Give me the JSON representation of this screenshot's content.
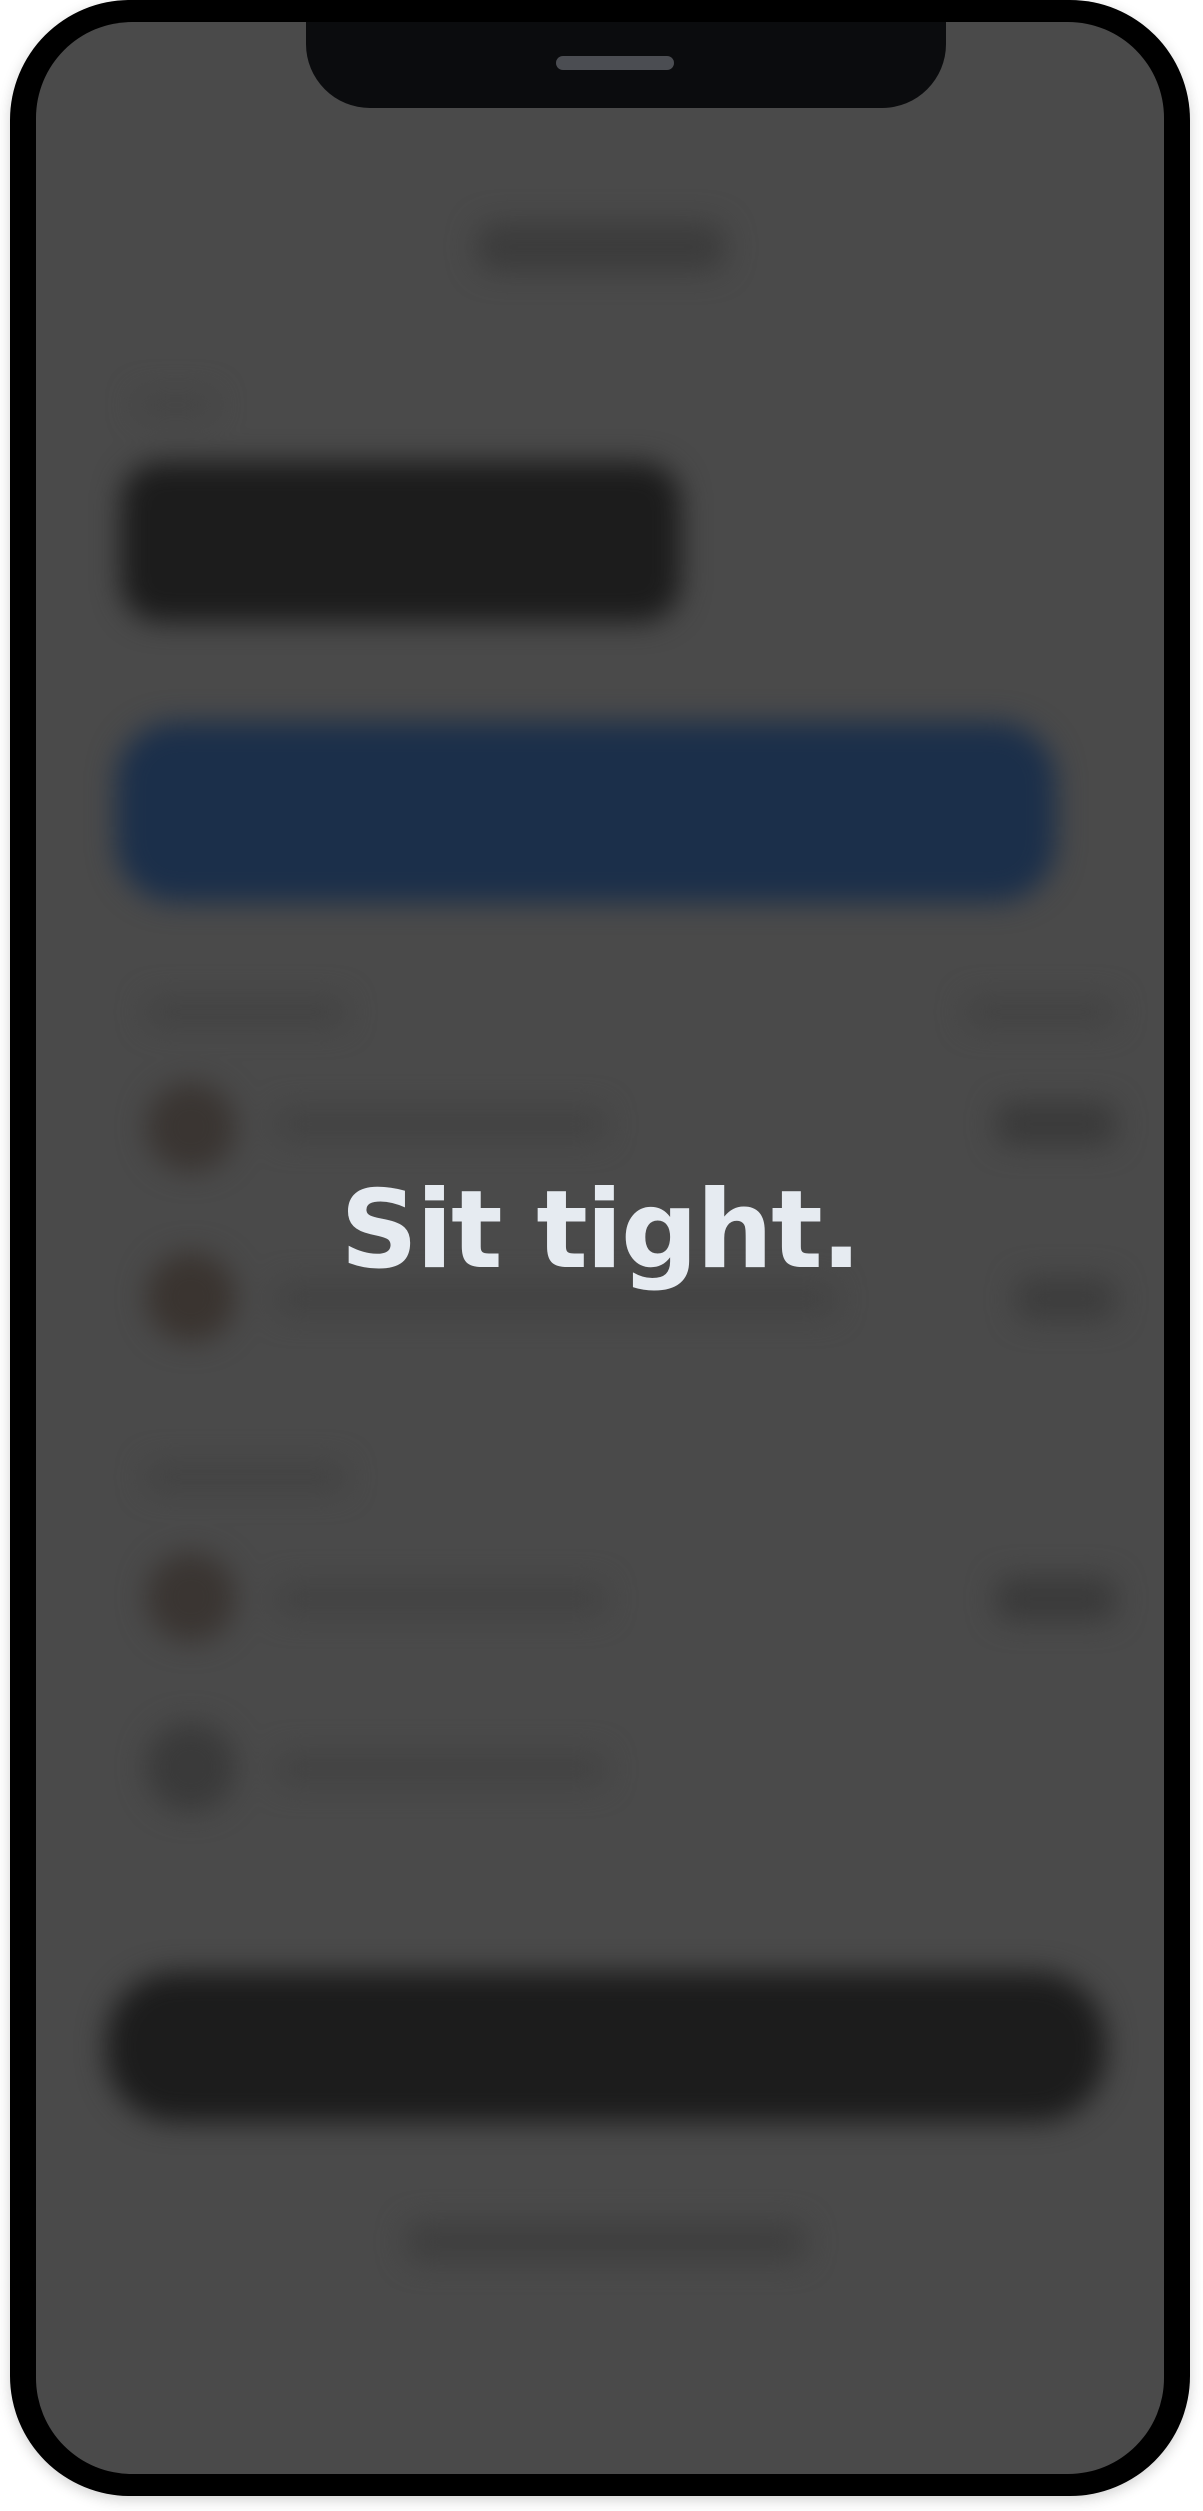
{
  "overlay": {
    "message": "Sit tight."
  },
  "colors": {
    "phone_frame": "#000000",
    "screen_dim": "#4a4a4a",
    "primary_button_blurred": "#1b2f4a",
    "message_text": "#e6ebf1"
  }
}
